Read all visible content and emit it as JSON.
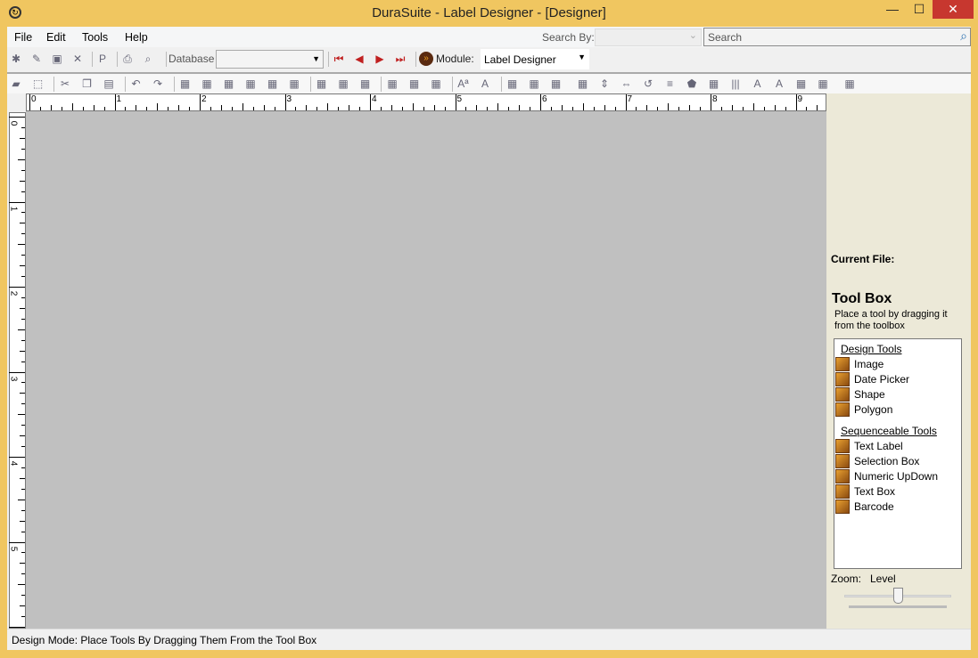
{
  "window": {
    "title": "DuraSuite - Label Designer - [Designer]",
    "minimize": "—",
    "maximize": "☐",
    "close": "✕"
  },
  "menu": [
    "File",
    "Edit",
    "Tools",
    "Help"
  ],
  "search": {
    "search_by_label": "Search By:",
    "search_by_value": "",
    "placeholder": "Search"
  },
  "toolbar1": {
    "database_label": "Database",
    "database_value": "",
    "module_label": "Module:",
    "module_value": "Label Designer",
    "icons": [
      "new-file-icon",
      "edit-icon",
      "save-icon",
      "delete-icon",
      "|",
      "ppe-icon",
      "|",
      "print-icon",
      "print-preview-icon"
    ],
    "nav_icons": [
      "first-record-icon",
      "previous-record-icon",
      "next-record-icon",
      "last-record-icon"
    ]
  },
  "toolbar2": {
    "icons": [
      "open-icon",
      "select-region-icon",
      "|",
      "cut-icon",
      "copy-icon",
      "paste-icon",
      "|",
      "undo-icon",
      "redo-icon",
      "|",
      "properties-icon",
      "snap-grid-icon",
      "center-horizontal-icon",
      "center-vertical-icon",
      "bring-front-icon",
      "send-back-icon",
      "|",
      "align-left-icon",
      "align-center-icon",
      "align-right-icon",
      "|",
      "align-top-icon",
      "align-middle-icon",
      "align-bottom-icon",
      "|",
      "font-size-icon",
      "font-icon",
      "|",
      "text-field-icon",
      "list-icon",
      "image-dropdown-icon",
      "picture-icon",
      "vertical-spacing-icon",
      "horizontal-spacing-icon",
      "rotate-icon",
      "line-icon",
      "polygon-icon",
      "numeric-icon",
      "barcode-icon",
      "text-frame-icon",
      "bold-text-icon",
      "text-label-icon",
      "align-dropdown-icon",
      "database-icon"
    ]
  },
  "ruler": {
    "horizontal": [
      "0",
      "1",
      "2",
      "3",
      "4",
      "5",
      "6",
      "7",
      "8",
      "9"
    ],
    "vertical": [
      "0",
      "1",
      "2",
      "3",
      "4",
      "5"
    ]
  },
  "panel": {
    "current_file_label": "Current File:",
    "current_file_value": "",
    "toolbox_title": "Tool Box",
    "toolbox_hint": "Place a tool by dragging it from the toolbox",
    "groups": [
      {
        "title": "Design Tools",
        "items": [
          "Image",
          "Date Picker",
          "Shape",
          "Polygon"
        ]
      },
      {
        "title": "Sequenceable Tools",
        "items": [
          "Text Label",
          "Selection Box",
          "Numeric UpDown",
          "Text Box",
          "Barcode"
        ]
      }
    ],
    "zoom_label": "Zoom:",
    "zoom_level_label": "Level",
    "zoom_value_percent": 50
  },
  "status": "Design Mode: Place Tools By Dragging Them From the Tool Box"
}
